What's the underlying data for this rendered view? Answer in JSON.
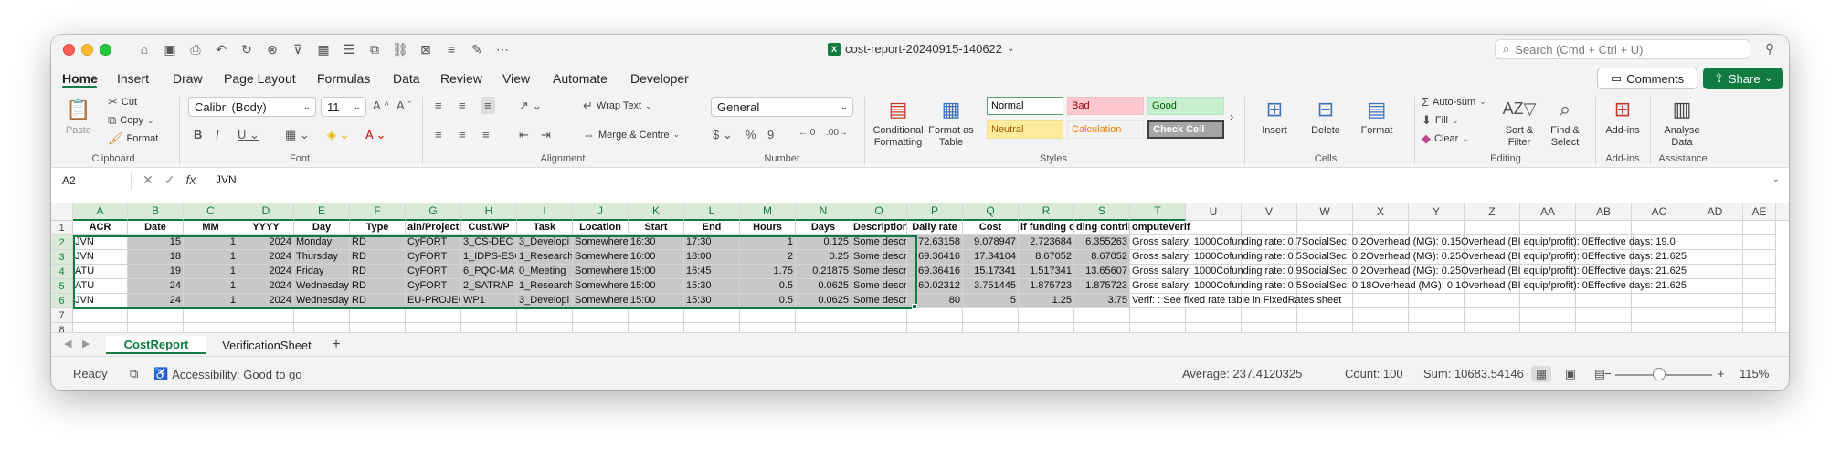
{
  "window": {
    "file_name": "cost-report-20240915-140622",
    "search_placeholder": "Search (Cmd + Ctrl + U)"
  },
  "ribbon_tabs": [
    "Home",
    "Insert",
    "Draw",
    "Page Layout",
    "Formulas",
    "Data",
    "Review",
    "View",
    "Automate",
    "Developer"
  ],
  "buttons": {
    "comments": "Comments",
    "share": "Share"
  },
  "ribbon": {
    "clipboard": {
      "label": "Clipboard",
      "paste": "Paste",
      "cut": "Cut",
      "copy": "Copy",
      "format": "Format"
    },
    "font": {
      "label": "Font",
      "font_name": "Calibri (Body)",
      "font_size": "11"
    },
    "alignment": {
      "label": "Alignment",
      "wrap": "Wrap Text",
      "merge": "Merge & Centre"
    },
    "number": {
      "label": "Number",
      "format": "General"
    },
    "styles": {
      "label": "Styles",
      "cond_format": "Conditional Formatting",
      "format_table": "Format as Table",
      "cells": [
        {
          "name": "Normal",
          "bg": "#ffffff",
          "fg": "#000000"
        },
        {
          "name": "Bad",
          "bg": "#ffc7ce",
          "fg": "#9c0006"
        },
        {
          "name": "Good",
          "bg": "#c6efce",
          "fg": "#006100"
        },
        {
          "name": "Neutral",
          "bg": "#ffeb9c",
          "fg": "#9c5700"
        },
        {
          "name": "Calculation",
          "bg": "#f2f2f2",
          "fg": "#fa7d00"
        },
        {
          "name": "Check Cell",
          "bg": "#a5a5a5",
          "fg": "#ffffff"
        }
      ]
    },
    "cells": {
      "label": "Cells",
      "insert": "Insert",
      "delete": "Delete",
      "format": "Format"
    },
    "editing": {
      "label": "Editing",
      "autosum": "Auto-sum",
      "fill": "Fill",
      "clear": "Clear",
      "sort": "Sort & Filter",
      "find": "Find & Select"
    },
    "addins": {
      "label": "Add-ins",
      "button": "Add-ins"
    },
    "assistance": {
      "label": "Assistance",
      "button": "Analyse Data"
    }
  },
  "formula_bar": {
    "name_box": "A2",
    "content": "JVN"
  },
  "columns": [
    "A",
    "B",
    "C",
    "D",
    "E",
    "F",
    "G",
    "H",
    "I",
    "J",
    "K",
    "L",
    "M",
    "N",
    "O",
    "P",
    "Q",
    "R",
    "S",
    "T",
    "U",
    "V",
    "W",
    "X",
    "Y",
    "Z",
    "AA",
    "AB",
    "AC",
    "AD",
    "AE"
  ],
  "rows": [
    [
      "ACR",
      "Date",
      "MM",
      "YYYY",
      "Day",
      "Type",
      "ain/Project",
      "Cust/WP",
      "Task",
      "Location",
      "Start",
      "End",
      "Hours",
      "Days",
      "Description",
      "Daily rate",
      "Cost",
      "lf funding co",
      "ding contrib",
      "omputeVerif"
    ],
    [
      "JVN",
      "15",
      "1",
      "2024",
      "Monday",
      "RD",
      "CyFORT",
      "3_CS-DEC",
      "3_Developi",
      "Somewhere",
      "16:30",
      "17:30",
      "1",
      "0.125",
      "Some descr",
      "72.63158",
      "9.078947",
      "2.723684",
      "6.355263",
      "Gross salary: 1000Cofunding rate: 0.7SocialSec: 0.2Overhead (MG): 0.15Overhead (BI equip/profit): 0Effective days: 19.0"
    ],
    [
      "JVN",
      "18",
      "1",
      "2024",
      "Thursday",
      "RD",
      "CyFORT",
      "1_IDPS-ESC",
      "1_Research",
      "Somewhere",
      "16:00",
      "18:00",
      "2",
      "0.25",
      "Some descr",
      "69.36416",
      "17.34104",
      "8.67052",
      "8.67052",
      "Gross salary: 1000Cofunding rate: 0.5SocialSec: 0.2Overhead (MG): 0.25Overhead (BI equip/profit): 0Effective days: 21.625"
    ],
    [
      "ATU",
      "19",
      "1",
      "2024",
      "Friday",
      "RD",
      "CyFORT",
      "6_PQC-MA",
      "0_Meeting",
      "Somewhere",
      "15:00",
      "16:45",
      "1.75",
      "0.21875",
      "Some descr",
      "69.36416",
      "15.17341",
      "1.517341",
      "13.65607",
      "Gross salary: 1000Cofunding rate: 0.9SocialSec: 0.2Overhead (MG): 0.25Overhead (BI equip/profit): 0Effective days: 21.625"
    ],
    [
      "ATU",
      "24",
      "1",
      "2024",
      "Wednesday",
      "RD",
      "CyFORT",
      "2_SATRAP",
      "1_Research",
      "Somewhere",
      "15:00",
      "15:30",
      "0.5",
      "0.0625",
      "Some descr",
      "60.02312",
      "3.751445",
      "1.875723",
      "1.875723",
      "Gross salary: 1000Cofunding rate: 0.5SocialSec: 0.18Overhead (MG): 0.1Overhead (BI equip/profit): 0Effective days: 21.625"
    ],
    [
      "JVN",
      "24",
      "1",
      "2024",
      "Wednesday",
      "RD",
      "EU-PROJEC",
      "WP1",
      "3_Developi",
      "Somewhere",
      "15:00",
      "15:30",
      "0.5",
      "0.0625",
      "Some descr",
      "80",
      "5",
      "1.25",
      "3.75",
      "Verif: : See fixed rate table in FixedRates sheet"
    ]
  ],
  "row_numbers": [
    "1",
    "2",
    "3",
    "4",
    "5",
    "6",
    "7",
    "8"
  ],
  "sheets": [
    "CostReport",
    "VerificationSheet"
  ],
  "status": {
    "ready": "Ready",
    "accessibility": "Accessibility: Good to go",
    "average": "Average: 237.4120325",
    "count": "Count: 100",
    "sum": "Sum: 10683.54146",
    "zoom": "115%"
  }
}
